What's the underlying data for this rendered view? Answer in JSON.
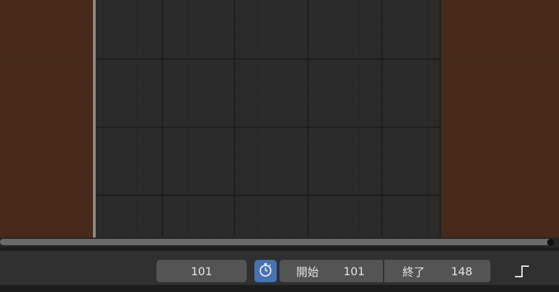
{
  "timeline": {
    "current_frame": "101",
    "preview_range_icon": "stopwatch-icon",
    "start_label": "開始",
    "start_value": "101",
    "end_label": "終了",
    "end_value": "148",
    "interpolation_icon": "constant-step-icon"
  },
  "colors": {
    "editor_background": "#2b2b2b",
    "out_of_range_tint": "#4a2a19",
    "accent": "#4772b3",
    "field_background": "#545454"
  }
}
